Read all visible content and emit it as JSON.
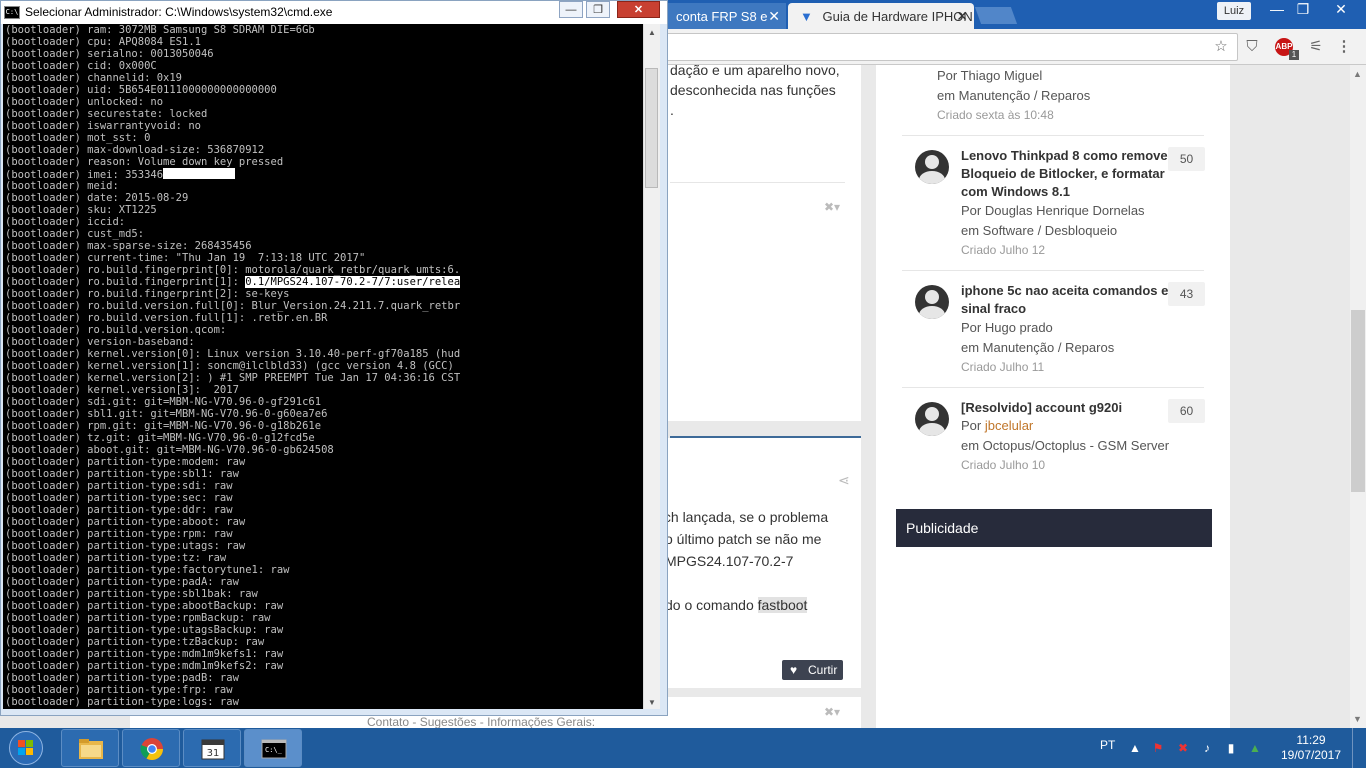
{
  "browser": {
    "tabs": [
      {
        "label": "conta FRP S8 e",
        "active": false
      },
      {
        "label": "Guia de Hardware IPHON",
        "active": true
      }
    ],
    "profile_name": "Luiz",
    "extension_abp_label": "ABP",
    "extension_abp_badge": "1"
  },
  "page": {
    "post_top_lines": [
      "dação e um aparelho novo,",
      "desconhecida nas funções",
      "."
    ],
    "post_bottom_lines": [
      "tch lançada, se o problema",
      "o último patch se não me",
      "MPGS24.107-70.2-7"
    ],
    "fastboot_prefix": "do o comando ",
    "fastboot_code": "fastboot",
    "like_button": "Curtir",
    "footer_links": "Contato - Sugestões - Informações Gerais:"
  },
  "sidebar": {
    "first_topic": {
      "author": "Por Thiago Miguel",
      "forum": "em Manutenção / Reparos",
      "date": "Criado sexta às 10:48"
    },
    "topics": [
      {
        "title": "Lenovo Thinkpad 8 como remover Bloqueio de Bitlocker, e formatar com Windows 8.1",
        "author": "Por Douglas Henrique Dornelas",
        "forum": "em Software / Desbloqueio",
        "date": "Criado Julho 12",
        "count": "50"
      },
      {
        "title": "iphone 5c nao aceita comandos e sinal fraco",
        "author": "Por Hugo prado",
        "forum": "em Manutenção / Reparos",
        "date": "Criado Julho 11",
        "count": "43"
      },
      {
        "title": "[Resolvido] account g920i",
        "author_prefix": "Por ",
        "author_link": "jbcelular",
        "forum": "em Octopus/Octoplus - GSM Server",
        "date": "Criado Julho 10",
        "count": "60"
      }
    ],
    "ad_header": "Publicidade"
  },
  "cmd": {
    "title": "Selecionar Administrador: C:\\Windows\\system32\\cmd.exe",
    "icon_text": "C:\\",
    "lines": [
      "(bootloader) ram: 3072MB Samsung S8 SDRAM DIE=6Gb",
      "(bootloader) cpu: APQ8084 ES1.1",
      "(bootloader) serialno: 0013050046",
      "(bootloader) cid: 0x000C",
      "(bootloader) channelid: 0x19",
      "(bootloader) uid: 5B654E0111000000000000000",
      "(bootloader) unlocked: no",
      "(bootloader) securestate: locked",
      "(bootloader) iswarrantyvoid: no",
      "(bootloader) mot_sst: 0",
      "(bootloader) max-download-size: 536870912",
      "(bootloader) reason: Volume down key pressed",
      "(bootloader) imei: 353346",
      "(bootloader) meid:",
      "(bootloader) date: 2015-08-29",
      "(bootloader) sku: XT1225",
      "(bootloader) iccid:",
      "(bootloader) cust_md5:",
      "(bootloader) max-sparse-size: 268435456",
      "(bootloader) current-time: \"Thu Jan 19  7:13:18 UTC 2017\"",
      "(bootloader) ro.build.fingerprint[0]: motorola/quark_retbr/quark_umts:6.",
      "(bootloader) ro.build.fingerprint[1]: ",
      "(bootloader) ro.build.fingerprint[2]: se-keys",
      "(bootloader) ro.build.version.full[0]: Blur_Version.24.211.7.quark_retbr",
      "(bootloader) ro.build.version.full[1]: .retbr.en.BR",
      "(bootloader) ro.build.version.qcom:",
      "(bootloader) version-baseband:",
      "(bootloader) kernel.version[0]: Linux version 3.10.40-perf-gf70a185 (hud",
      "(bootloader) kernel.version[1]: soncm@ilclbld33) (gcc version 4.8 (GCC)",
      "(bootloader) kernel.version[2]: ) #1 SMP PREEMPT Tue Jan 17 04:36:16 CST",
      "(bootloader) kernel.version[3]:  2017",
      "(bootloader) sdi.git: git=MBM-NG-V70.96-0-gf291c61",
      "(bootloader) sbl1.git: git=MBM-NG-V70.96-0-g60ea7e6",
      "(bootloader) rpm.git: git=MBM-NG-V70.96-0-g18b261e",
      "(bootloader) tz.git: git=MBM-NG-V70.96-0-g12fcd5e",
      "(bootloader) aboot.git: git=MBM-NG-V70.96-0-gb624508",
      "(bootloader) partition-type:modem: raw",
      "(bootloader) partition-type:sbl1: raw",
      "(bootloader) partition-type:sdi: raw",
      "(bootloader) partition-type:sec: raw",
      "(bootloader) partition-type:ddr: raw",
      "(bootloader) partition-type:aboot: raw",
      "(bootloader) partition-type:rpm: raw",
      "(bootloader) partition-type:utags: raw",
      "(bootloader) partition-type:tz: raw",
      "(bootloader) partition-type:factorytune1: raw",
      "(bootloader) partition-type:padA: raw",
      "(bootloader) partition-type:sbl1bak: raw",
      "(bootloader) partition-type:abootBackup: raw",
      "(bootloader) partition-type:rpmBackup: raw",
      "(bootloader) partition-type:utagsBackup: raw",
      "(bootloader) partition-type:tzBackup: raw",
      "(bootloader) partition-type:mdm1m9kefs1: raw",
      "(bootloader) partition-type:mdm1m9kefs2: raw",
      "(bootloader) partition-type:padB: raw",
      "(bootloader) partition-type:frp: raw",
      "(bootloader) partition-type:logs: raw"
    ],
    "selected_text": "0.1/MPGS24.107-70.2-7/7:user/relea"
  },
  "taskbar": {
    "language": "PT",
    "time": "11:29",
    "date": "19/07/2017",
    "apps": [
      "explorer",
      "chrome",
      "calendar",
      "cmd"
    ]
  },
  "colors": {
    "chrome_frame": "#1f5fb2",
    "taskbar": "#1f5b9c",
    "publicidade_bg": "#272b3b",
    "author_link": "#c0762a"
  }
}
